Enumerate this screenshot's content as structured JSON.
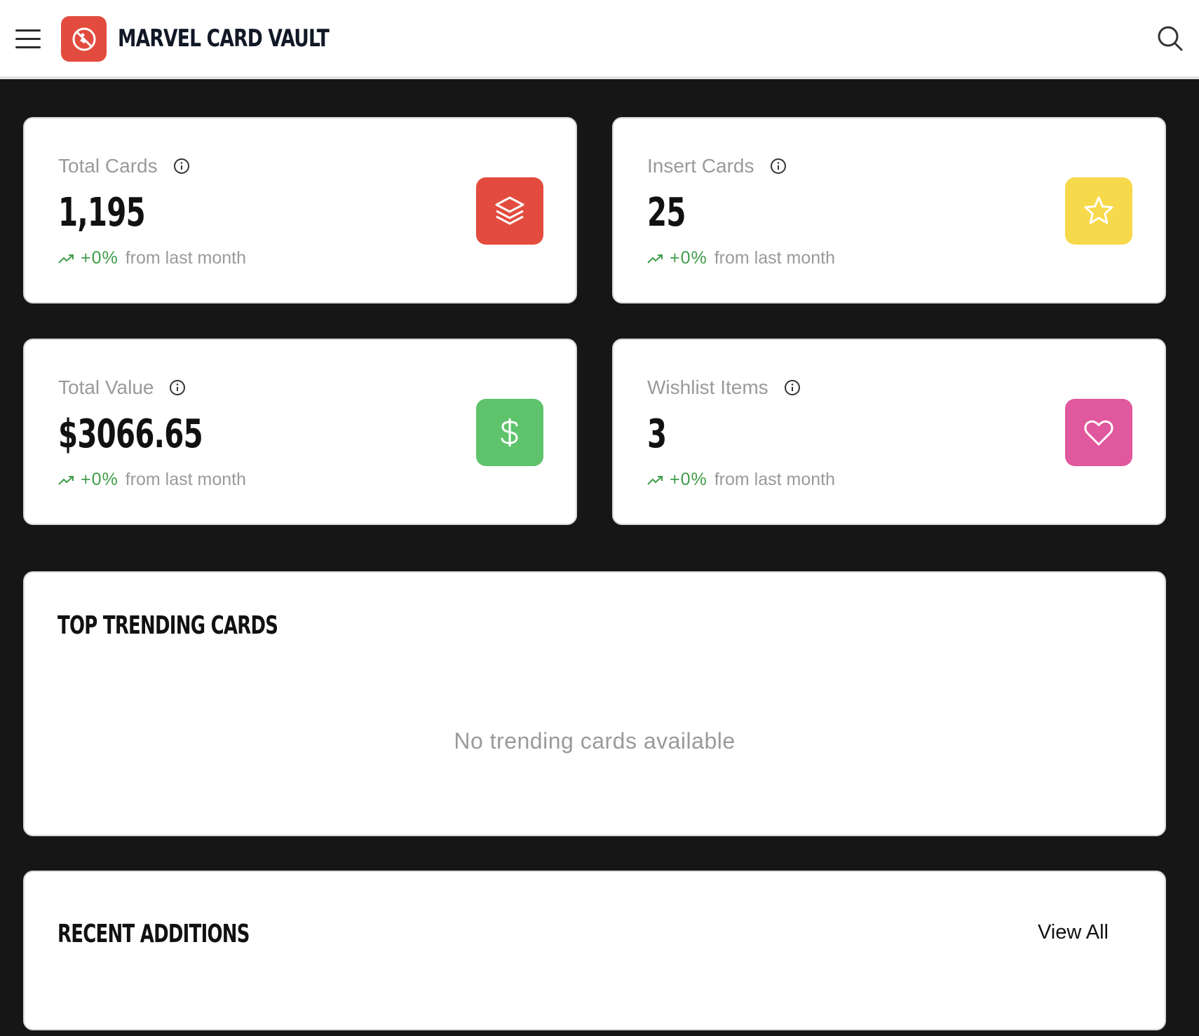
{
  "header": {
    "title": "MARVEL CARD VAULT",
    "menu_icon": "hamburger-menu-icon",
    "logo_icon": "superhero-logo-icon",
    "search_icon": "search-icon"
  },
  "stats": [
    {
      "label": "Total Cards",
      "value": "1,195",
      "change": "+0%",
      "change_text": "from last month",
      "icon": "layers-icon",
      "color": "#e24b3d"
    },
    {
      "label": "Insert Cards",
      "value": "25",
      "change": "+0%",
      "change_text": "from last month",
      "icon": "star-icon",
      "color": "#f7d94c"
    },
    {
      "label": "Total Value",
      "value": "$3066.65",
      "change": "+0%",
      "change_text": "from last month",
      "icon": "dollar-icon",
      "color": "#5ec36a"
    },
    {
      "label": "Wishlist Items",
      "value": "3",
      "change": "+0%",
      "change_text": "from last month",
      "icon": "heart-icon",
      "color": "#e0589e"
    }
  ],
  "trending": {
    "title": "TOP TRENDING CARDS",
    "empty_message": "No trending cards available"
  },
  "recent": {
    "title": "RECENT ADDITIONS",
    "view_all_label": "View All"
  },
  "colors": {
    "background": "#161616",
    "positive": "#3f9c48",
    "muted": "#9a9a9a"
  }
}
